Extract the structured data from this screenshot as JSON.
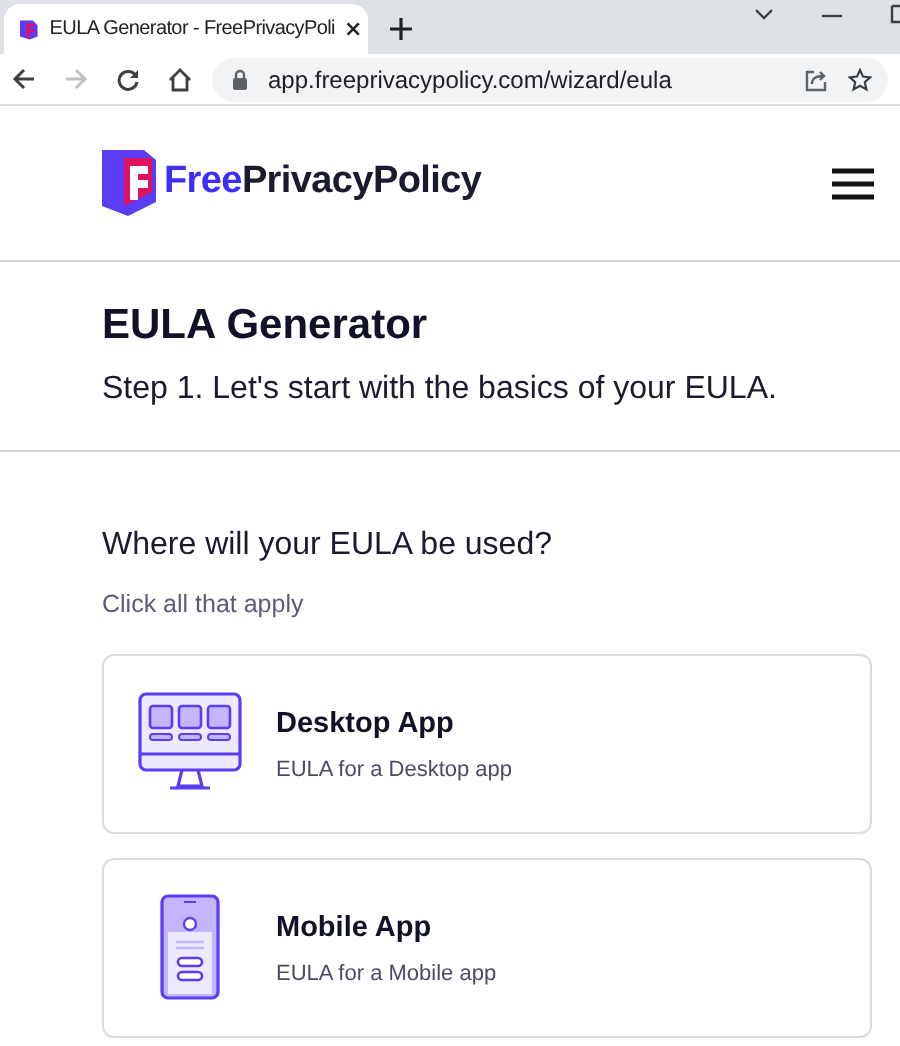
{
  "browser": {
    "tab_title": "EULA Generator - FreePrivacyPoli",
    "address": "app.freeprivacypolicy.com/wizard/eula"
  },
  "logo": {
    "first": "Free",
    "rest": "PrivacyPolicy"
  },
  "heading": {
    "title": "EULA Generator",
    "step": "Step 1. Let's start with the basics of your EULA."
  },
  "question": {
    "label": "Where will your EULA be used?",
    "hint": "Click all that apply"
  },
  "options": [
    {
      "kind": "desktop",
      "title": "Desktop App",
      "description": "EULA for a Desktop app"
    },
    {
      "kind": "mobile",
      "title": "Mobile App",
      "description": "EULA for a Mobile app"
    }
  ]
}
